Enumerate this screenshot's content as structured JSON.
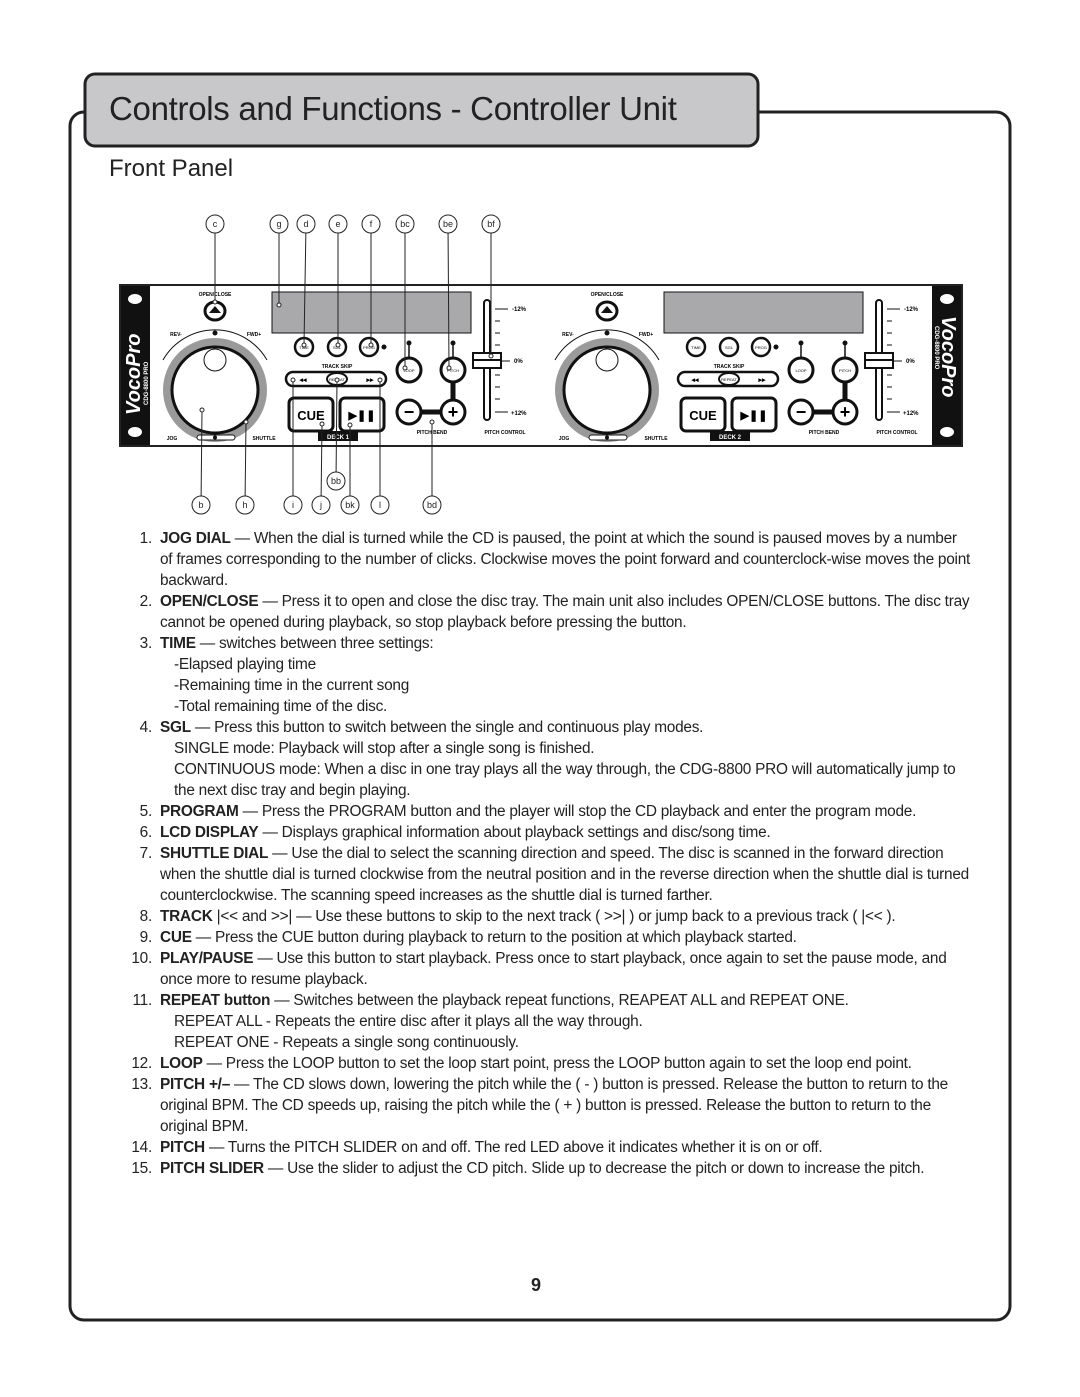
{
  "header": {
    "title": "Controls and Functions - Controller Unit",
    "subtitle": "Front Panel"
  },
  "diagram": {
    "brand": "VocoPro",
    "model": "CDG-8800 PRO",
    "labels": {
      "open_close": "OPEN/CLOSE",
      "rev": "REV-",
      "fwd": "FWD+",
      "jog": "JOG",
      "shuttle": "SHUTTLE",
      "time": "TIME",
      "sgl": "SGL",
      "prog": "PROG",
      "track_skip": "TRACK SKIP",
      "repeat": "REPEAT",
      "loop": "LOOP",
      "pitch": "PITCH",
      "cue": "CUE",
      "pitch_bend": "PITCH BEND",
      "pitch_control": "PITCH CONTROL",
      "minus12": "-12%",
      "zero": "0%",
      "plus12": "+12%"
    },
    "decks": [
      "DECK 1",
      "DECK 2"
    ],
    "callouts_top": [
      "c",
      "g",
      "d",
      "e",
      "f",
      "bc",
      "be",
      "bf"
    ],
    "callouts_bottom": [
      "b",
      "h",
      "i",
      "j",
      "bk",
      "l",
      "bd"
    ],
    "callout_mid": "bb"
  },
  "items": [
    {
      "num": "1.",
      "term": "JOG DIAL",
      "text": " — When the dial is turned while the CD is paused, the point at which the sound is paused moves by a number of frames corresponding to the number of clicks. Clockwise moves the point forward and counterclock-wise moves the point backward.",
      "sub": []
    },
    {
      "num": "2.",
      "term": "OPEN/CLOSE",
      "text": " — Press it to open and close the disc tray. The main unit also includes OPEN/CLOSE buttons. The disc tray cannot be opened during playback, so stop playback before pressing the button.",
      "sub": []
    },
    {
      "num": "3.",
      "term": "TIME",
      "text": " — switches between three settings:",
      "sub": [
        "-Elapsed playing time",
        "-Remaining time in the current song",
        "-Total remaining time of the disc."
      ]
    },
    {
      "num": "4.",
      "term": "SGL",
      "text": " — Press this button to switch between the single and continuous play modes.",
      "sub": [
        "SINGLE mode: Playback will stop after a single song is finished.",
        "CONTINUOUS mode: When a disc in one tray plays all the way through, the CDG-8800 PRO will automatically jump to the next disc tray and begin playing."
      ]
    },
    {
      "num": "5.",
      "term": "PROGRAM",
      "text": " — Press the PROGRAM button and the player will stop the CD playback and enter the program mode.",
      "sub": []
    },
    {
      "num": "6.",
      "term": "LCD DISPLAY",
      "text": " — Displays graphical information about playback settings and disc/song time.",
      "sub": []
    },
    {
      "num": "7.",
      "term": "SHUTTLE DIAL",
      "text": " — Use the dial to select the scanning direction and speed. The disc is scanned in the forward direction when the shuttle dial is turned clockwise from the neutral position and in the reverse direction when the  shuttle dial is turned counterclockwise. The scanning speed increases as the shuttle dial is turned farther.",
      "sub": []
    },
    {
      "num": "8.",
      "term": "TRACK",
      "text": " |<< and >>| — Use these buttons to skip to the next track ( >>| ) or jump back to a previous track ( |<< ).",
      "sub": []
    },
    {
      "num": "9.",
      "term": "CUE",
      "text": " — Press the CUE button during playback to return to the position at which playback started.",
      "sub": []
    },
    {
      "num": "10.",
      "term": "PLAY/PAUSE",
      "text": " — Use this button to start playback. Press once to start playback, once again to set the pause mode, and once more to resume playback.",
      "sub": []
    },
    {
      "num": "11.",
      "term": "REPEAT button",
      "text": " — Switches between the playback repeat functions, REAPEAT ALL and REPEAT ONE.",
      "sub": [
        "REPEAT ALL - Repeats the entire disc after it plays all the way through.",
        "REPEAT ONE - Repeats a single song continuously."
      ]
    },
    {
      "num": "12.",
      "term": "LOOP",
      "text": " — Press the LOOP button to set the loop start point, press the LOOP button again to set the loop end point.",
      "sub": []
    },
    {
      "num": "13.",
      "term": "PITCH +/–",
      "text": " — The CD slows down, lowering the pitch while the ( - ) button is pressed. Release the button to return to the original BPM. The CD speeds up, raising the pitch while the ( + ) button is pressed. Release the button to return to the original BPM.",
      "sub": []
    },
    {
      "num": "14.",
      "term": "PITCH",
      "text": " — Turns the PITCH SLIDER on and off.  The red LED above it indicates whether it is on or off.",
      "sub": []
    },
    {
      "num": "15.",
      "term": "PITCH SLIDER",
      "text": " — Use the slider to adjust the CD pitch. Slide up to decrease the pitch or down to increase the pitch.",
      "sub": []
    }
  ],
  "footer": {
    "page_number": "9"
  },
  "colors": {
    "title_tab": "#c8c8cb",
    "lcd": "#a9a9ab",
    "ink": "#222222"
  }
}
